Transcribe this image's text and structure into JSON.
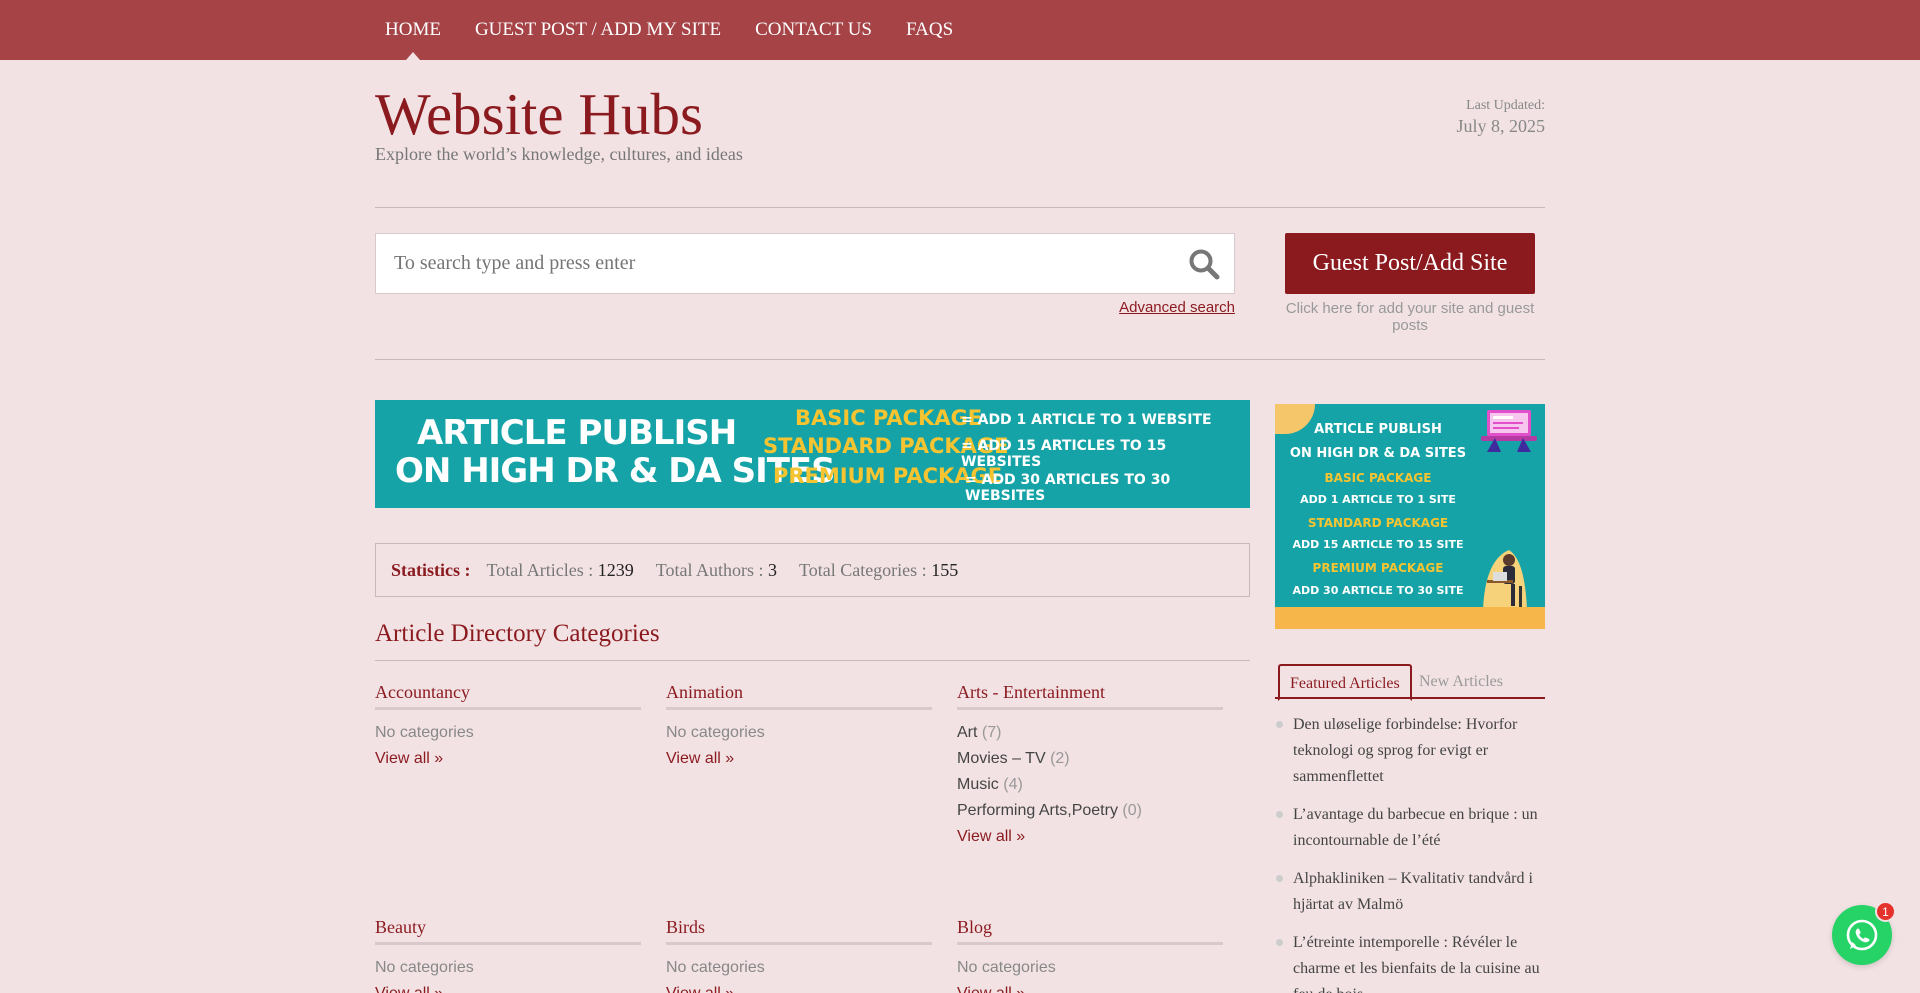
{
  "nav": {
    "items": [
      {
        "label": "HOME",
        "active": true
      },
      {
        "label": "GUEST POST / ADD MY SITE"
      },
      {
        "label": "CONTACT US"
      },
      {
        "label": "FAQS"
      }
    ]
  },
  "header": {
    "title": "Website Hubs",
    "tagline": "Explore the world’s knowledge, cultures, and ideas",
    "last_updated_label": "Last Updated:",
    "last_updated_date": "July 8, 2025"
  },
  "search": {
    "placeholder": "To search type and press enter",
    "advanced_label": "Advanced search",
    "guest_button": "Guest Post/Add Site",
    "guest_note": "Click here for add your site and guest posts"
  },
  "banner_wide": {
    "title_line1": "ARTICLE PUBLISH",
    "title_line2": "ON HIGH DR & DA SITES",
    "pkg1": "BASIC PACKAGE",
    "pkg2": "STANDARD PACKAGE",
    "pkg3": "PREMIUM PACKAGE",
    "eq1": "= ADD 1 ARTICLE TO 1 WEBSITE",
    "eq2": "= ADD 15 ARTICLES TO 15 WEBSITES",
    "eq3": "= ADD 30 ARTICLES TO 30 WEBSITES"
  },
  "stats": {
    "label": "Statistics :",
    "articles_label": "Total Articles :",
    "articles_value": "1239",
    "authors_label": "Total Authors :",
    "authors_value": "3",
    "categories_label": "Total Categories :",
    "categories_value": "155"
  },
  "directory": {
    "title": "Article Directory Categories",
    "none_text": "No categories",
    "view_all": "View all »",
    "categories": [
      {
        "title": "Accountancy"
      },
      {
        "title": "Animation"
      },
      {
        "title": "Arts - Entertainment",
        "subs": [
          {
            "name": "Art",
            "count": "(7)"
          },
          {
            "name": "Movies – TV",
            "count": "(2)"
          },
          {
            "name": "Music",
            "count": "(4)"
          },
          {
            "name": "Performing Arts,Poetry",
            "count": "(0)"
          }
        ]
      },
      {
        "title": "Beauty"
      },
      {
        "title": "Birds"
      },
      {
        "title": "Blog"
      }
    ]
  },
  "banner_side": {
    "l1": "ARTICLE PUBLISH",
    "l2": "ON HIGH DR & DA SITES",
    "l3": "BASIC PACKAGE",
    "l4": "ADD 1 ARTICLE TO 1 SITE",
    "l5": "STANDARD PACKAGE",
    "l6": "ADD 15 ARTICLE TO 15 SITE",
    "l7": "PREMIUM PACKAGE",
    "l8": "ADD 30 ARTICLE TO 30 SITE"
  },
  "tabs": {
    "featured": "Featured Articles",
    "new": "New Articles"
  },
  "articles": [
    "Den uløselige forbindelse: Hvorfor teknologi og sprog for evigt er sammenflettet",
    "L’avantage du barbecue en brique : un incontournable de l’été",
    "Alphakliniken – Kvalitativ tandvård i hjärtat av Malmö",
    "L’étreinte intemporelle : Révéler le charme et les bienfaits de la cuisine au feu de bois"
  ],
  "whatsapp": {
    "badge": "1"
  },
  "colors": {
    "nav_bg": "#a54347",
    "accent": "#8b1a1f",
    "page_bg": "#f2e2e4",
    "banner_teal": "#15a3a7",
    "banner_yellow": "#f6c431",
    "whatsapp": "#25d366"
  }
}
